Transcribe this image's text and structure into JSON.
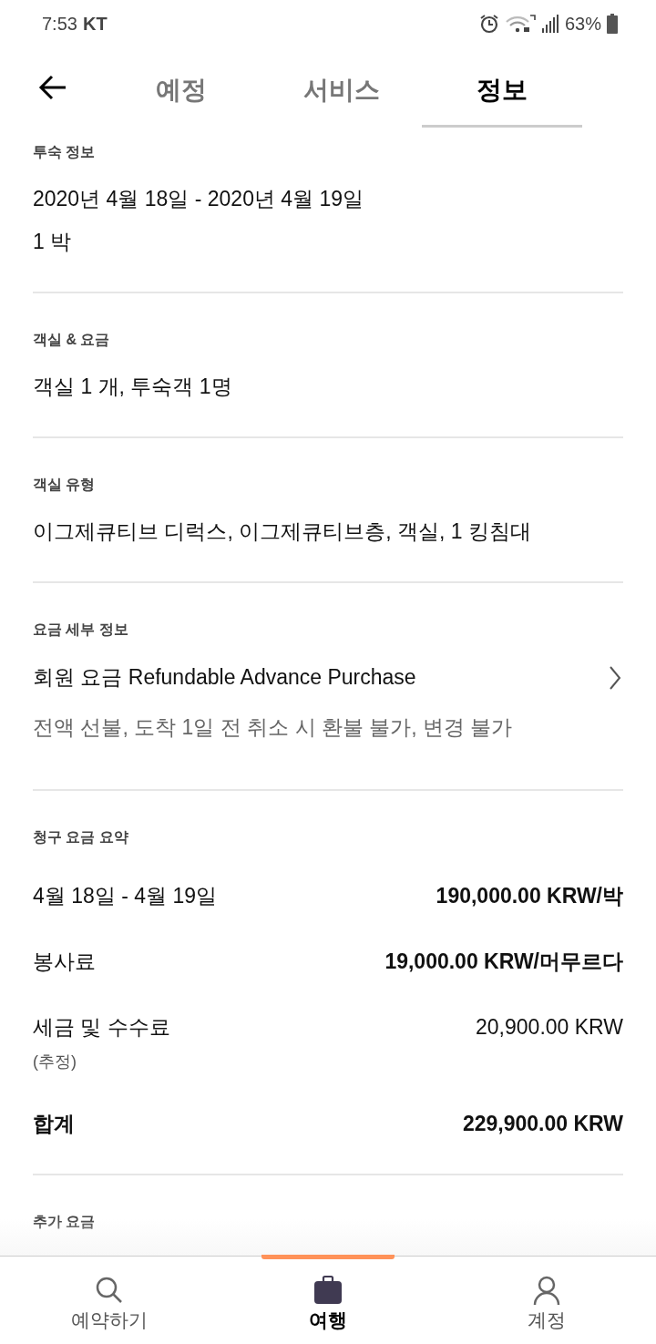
{
  "status_bar": {
    "time": "7:53",
    "carrier": "KT",
    "battery": "63%"
  },
  "tabs": [
    {
      "label": "예정",
      "selected": false
    },
    {
      "label": "서비스",
      "selected": false
    },
    {
      "label": "정보",
      "selected": true
    }
  ],
  "sections": [
    {
      "kind": "lines",
      "label": "투숙 정보",
      "lines": [
        "2020년 4월 18일 - 2020년 4월 19일",
        "1 박"
      ]
    },
    {
      "kind": "lines",
      "label": "객실 & 요금",
      "lines": [
        "객실 1 개, 투숙객 1명"
      ]
    },
    {
      "kind": "lines",
      "label": "객실 유형",
      "lines": [
        "이그제큐티브 디럭스, 이그제큐티브층, 객실, 1 킹침대"
      ]
    },
    {
      "kind": "rate",
      "label": "요금 세부 정보",
      "title": "회원 요금 Refundable Advance Purchase",
      "subtitle": "전액 선불, 도착 1일 전 취소 시 환불 불가, 변경 불가"
    },
    {
      "kind": "summary",
      "label": "청구 요금 요약",
      "rows": [
        {
          "kind": "charge",
          "label": "4월 18일 - 4월 19일",
          "amount": "190,000.00 KRW/박",
          "bold_amount": true
        },
        {
          "kind": "charge",
          "label": "봉사료",
          "amount": "19,000.00 KRW/머무르다",
          "bold_amount": true
        },
        {
          "kind": "charge",
          "label": "세금 및 수수료",
          "note": "(추정)",
          "amount": "20,900.00 KRW",
          "bold_amount": false
        },
        {
          "kind": "total",
          "label": "합계",
          "amount": "229,900.00 KRW",
          "bold_amount": true
        }
      ]
    },
    {
      "kind": "heading",
      "label": "추가 요금"
    }
  ],
  "bottom_nav": [
    {
      "label": "예약하기",
      "selected": false
    },
    {
      "label": "여행",
      "selected": true
    },
    {
      "label": "계정",
      "selected": false
    }
  ]
}
